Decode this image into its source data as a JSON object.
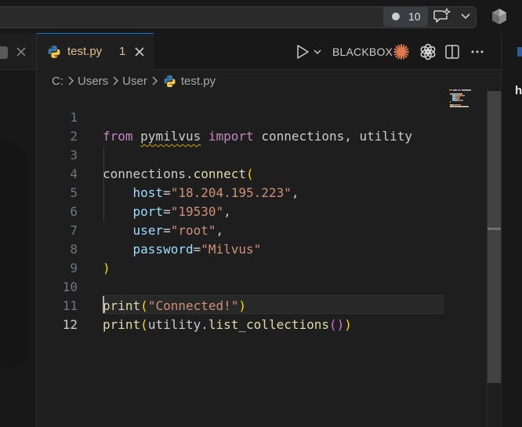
{
  "titlebar": {
    "notification_count": "10"
  },
  "tab": {
    "filename": "test.py",
    "problem_count": "1"
  },
  "toolbar": {
    "blackbox_label": "BLACKBOX"
  },
  "breadcrumb": {
    "parts": [
      "C:",
      "Users",
      "User",
      "test.py"
    ]
  },
  "editor": {
    "active_line": 12,
    "line_numbers": [
      "1",
      "2",
      "3",
      "4",
      "5",
      "6",
      "7",
      "8",
      "9",
      "10",
      "11",
      "12"
    ],
    "code": {
      "l1_from": "from",
      "l1_module": "pymilvus",
      "l1_import": "import",
      "l1_rest": "connections, utility",
      "l3_obj": "connections.",
      "l3_fn": "connect",
      "l3_paren": "(",
      "l4_param": "host",
      "l4_eq": "=",
      "l4_val": "\"18.204.195.223\"",
      "l4_comma": ",",
      "l5_param": "port",
      "l5_eq": "=",
      "l5_val": "\"19530\"",
      "l5_comma": ",",
      "l6_param": "user",
      "l6_eq": "=",
      "l6_val": "\"root\"",
      "l6_comma": ",",
      "l7_param": "password",
      "l7_eq": "=",
      "l7_val": "\"Milvus\"",
      "l8_paren": ")",
      "l10_fn": "print",
      "l10_open": "(",
      "l10_val": "\"Connected!\"",
      "l10_close": ")",
      "l11_fn": "print",
      "l11_open": "(",
      "l11_obj": "utility.",
      "l11_fn2": "list_collections",
      "l11_open2": "()",
      "l11_close": ")"
    }
  },
  "right_panel": {
    "heading": "h"
  },
  "icons": [
    "chat-sparkle-icon",
    "chevron-down-icon",
    "copilot-icon",
    "close-icon",
    "python-icon",
    "run-icon",
    "claude-icon",
    "openai-icon",
    "split-editor-icon",
    "more-icon"
  ],
  "colors": {
    "keyword": "#c586c0",
    "function": "#dcdcaa",
    "string": "#ce9178",
    "parameter": "#9cdcfe",
    "bracket_level1": "#ffd700",
    "bracket_level2": "#da70d6",
    "tab_modified": "#e2c08d",
    "accent": "#0078d4"
  }
}
